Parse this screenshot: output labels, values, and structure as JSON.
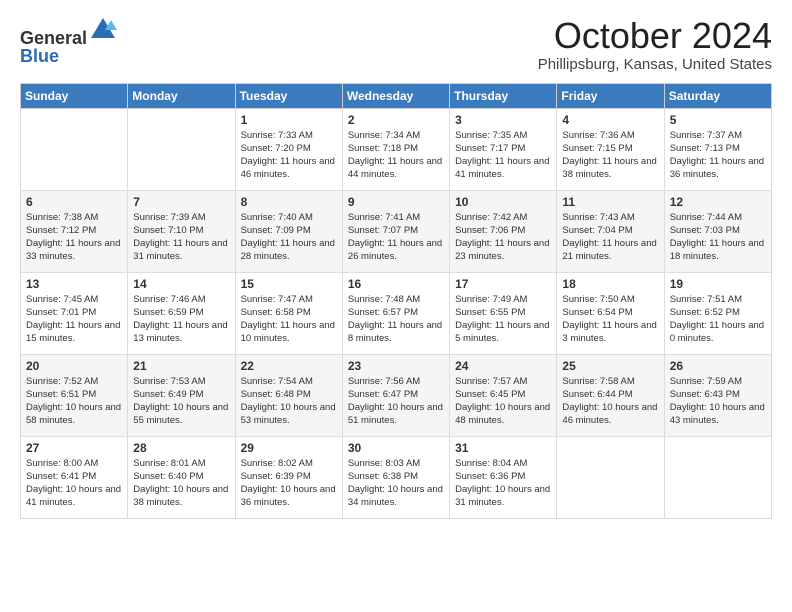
{
  "header": {
    "logo_line1": "General",
    "logo_line2": "Blue",
    "title": "October 2024",
    "location": "Phillipsburg, Kansas, United States"
  },
  "days_of_week": [
    "Sunday",
    "Monday",
    "Tuesday",
    "Wednesday",
    "Thursday",
    "Friday",
    "Saturday"
  ],
  "weeks": [
    [
      {
        "day": "",
        "info": ""
      },
      {
        "day": "",
        "info": ""
      },
      {
        "day": "1",
        "info": "Sunrise: 7:33 AM\nSunset: 7:20 PM\nDaylight: 11 hours and 46 minutes."
      },
      {
        "day": "2",
        "info": "Sunrise: 7:34 AM\nSunset: 7:18 PM\nDaylight: 11 hours and 44 minutes."
      },
      {
        "day": "3",
        "info": "Sunrise: 7:35 AM\nSunset: 7:17 PM\nDaylight: 11 hours and 41 minutes."
      },
      {
        "day": "4",
        "info": "Sunrise: 7:36 AM\nSunset: 7:15 PM\nDaylight: 11 hours and 38 minutes."
      },
      {
        "day": "5",
        "info": "Sunrise: 7:37 AM\nSunset: 7:13 PM\nDaylight: 11 hours and 36 minutes."
      }
    ],
    [
      {
        "day": "6",
        "info": "Sunrise: 7:38 AM\nSunset: 7:12 PM\nDaylight: 11 hours and 33 minutes."
      },
      {
        "day": "7",
        "info": "Sunrise: 7:39 AM\nSunset: 7:10 PM\nDaylight: 11 hours and 31 minutes."
      },
      {
        "day": "8",
        "info": "Sunrise: 7:40 AM\nSunset: 7:09 PM\nDaylight: 11 hours and 28 minutes."
      },
      {
        "day": "9",
        "info": "Sunrise: 7:41 AM\nSunset: 7:07 PM\nDaylight: 11 hours and 26 minutes."
      },
      {
        "day": "10",
        "info": "Sunrise: 7:42 AM\nSunset: 7:06 PM\nDaylight: 11 hours and 23 minutes."
      },
      {
        "day": "11",
        "info": "Sunrise: 7:43 AM\nSunset: 7:04 PM\nDaylight: 11 hours and 21 minutes."
      },
      {
        "day": "12",
        "info": "Sunrise: 7:44 AM\nSunset: 7:03 PM\nDaylight: 11 hours and 18 minutes."
      }
    ],
    [
      {
        "day": "13",
        "info": "Sunrise: 7:45 AM\nSunset: 7:01 PM\nDaylight: 11 hours and 15 minutes."
      },
      {
        "day": "14",
        "info": "Sunrise: 7:46 AM\nSunset: 6:59 PM\nDaylight: 11 hours and 13 minutes."
      },
      {
        "day": "15",
        "info": "Sunrise: 7:47 AM\nSunset: 6:58 PM\nDaylight: 11 hours and 10 minutes."
      },
      {
        "day": "16",
        "info": "Sunrise: 7:48 AM\nSunset: 6:57 PM\nDaylight: 11 hours and 8 minutes."
      },
      {
        "day": "17",
        "info": "Sunrise: 7:49 AM\nSunset: 6:55 PM\nDaylight: 11 hours and 5 minutes."
      },
      {
        "day": "18",
        "info": "Sunrise: 7:50 AM\nSunset: 6:54 PM\nDaylight: 11 hours and 3 minutes."
      },
      {
        "day": "19",
        "info": "Sunrise: 7:51 AM\nSunset: 6:52 PM\nDaylight: 11 hours and 0 minutes."
      }
    ],
    [
      {
        "day": "20",
        "info": "Sunrise: 7:52 AM\nSunset: 6:51 PM\nDaylight: 10 hours and 58 minutes."
      },
      {
        "day": "21",
        "info": "Sunrise: 7:53 AM\nSunset: 6:49 PM\nDaylight: 10 hours and 55 minutes."
      },
      {
        "day": "22",
        "info": "Sunrise: 7:54 AM\nSunset: 6:48 PM\nDaylight: 10 hours and 53 minutes."
      },
      {
        "day": "23",
        "info": "Sunrise: 7:56 AM\nSunset: 6:47 PM\nDaylight: 10 hours and 51 minutes."
      },
      {
        "day": "24",
        "info": "Sunrise: 7:57 AM\nSunset: 6:45 PM\nDaylight: 10 hours and 48 minutes."
      },
      {
        "day": "25",
        "info": "Sunrise: 7:58 AM\nSunset: 6:44 PM\nDaylight: 10 hours and 46 minutes."
      },
      {
        "day": "26",
        "info": "Sunrise: 7:59 AM\nSunset: 6:43 PM\nDaylight: 10 hours and 43 minutes."
      }
    ],
    [
      {
        "day": "27",
        "info": "Sunrise: 8:00 AM\nSunset: 6:41 PM\nDaylight: 10 hours and 41 minutes."
      },
      {
        "day": "28",
        "info": "Sunrise: 8:01 AM\nSunset: 6:40 PM\nDaylight: 10 hours and 38 minutes."
      },
      {
        "day": "29",
        "info": "Sunrise: 8:02 AM\nSunset: 6:39 PM\nDaylight: 10 hours and 36 minutes."
      },
      {
        "day": "30",
        "info": "Sunrise: 8:03 AM\nSunset: 6:38 PM\nDaylight: 10 hours and 34 minutes."
      },
      {
        "day": "31",
        "info": "Sunrise: 8:04 AM\nSunset: 6:36 PM\nDaylight: 10 hours and 31 minutes."
      },
      {
        "day": "",
        "info": ""
      },
      {
        "day": "",
        "info": ""
      }
    ]
  ]
}
